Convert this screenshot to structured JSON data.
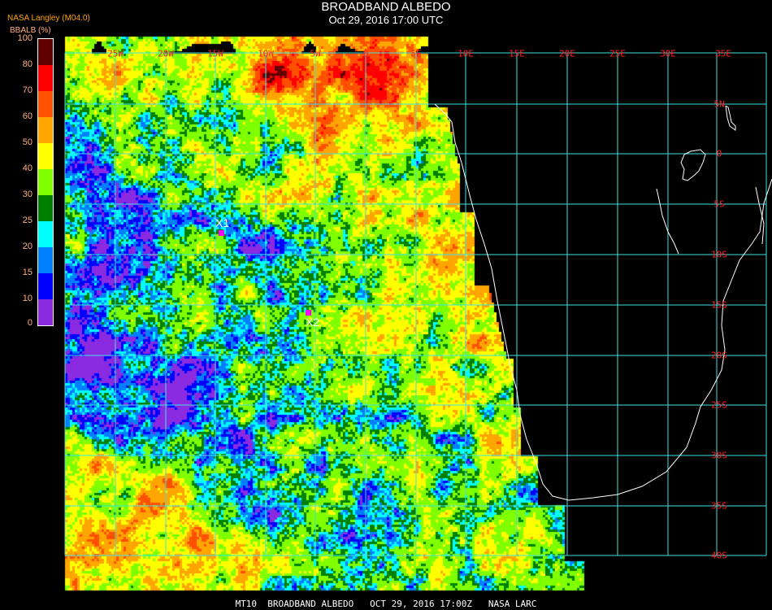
{
  "header": {
    "title": "BROADBAND ALBEDO",
    "subtitle": "Oct 29, 2016 17:00 UTC",
    "org": "NASA Langley (M04.0)",
    "units": "BBALB (%)"
  },
  "legend": {
    "ticks": [
      "100",
      "80",
      "70",
      "60",
      "50",
      "40",
      "30",
      "25",
      "20",
      "15",
      "10",
      "0"
    ],
    "colors": [
      "#600000",
      "#ff0000",
      "#ff5000",
      "#ffa500",
      "#ffff00",
      "#80ff00",
      "#008000",
      "#00ffff",
      "#0080ff",
      "#0000ff",
      "#8a2be2"
    ]
  },
  "grid": {
    "color": "#40e0e0",
    "lon_labels": [
      "25W",
      "20W",
      "15W",
      "10W",
      "5W",
      "0",
      "5E",
      "10E",
      "15E",
      "20E",
      "25E",
      "30E",
      "35E"
    ],
    "lat_labels": [
      "5N",
      "0",
      "5S",
      "10S",
      "15S",
      "20S",
      "25S",
      "30S",
      "35S",
      "40S"
    ]
  },
  "markers": [
    {
      "label": "X1"
    },
    {
      "label": "X2"
    }
  ],
  "marker_color": "#ff00ff",
  "footer": "MT10  BROADBAND ALBEDO   OCT 29, 2016 17:00Z   NASA LARC"
}
